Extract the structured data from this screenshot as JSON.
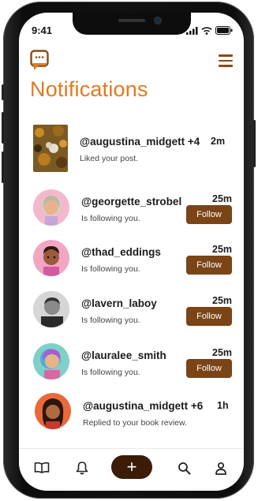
{
  "status_bar": {
    "time": "9:41"
  },
  "header": {
    "title": "Notifications"
  },
  "notifications": [
    {
      "username": "@augustina_midgett +4",
      "message": "Liked your post.",
      "time": "2m"
    },
    {
      "username": "@georgette_strobel",
      "message": "Is following you.",
      "time": "25m",
      "button": "Follow"
    },
    {
      "username": "@thad_eddings",
      "message": "Is following you.",
      "time": "25m",
      "button": "Follow"
    },
    {
      "username": "@lavern_laboy",
      "message": "Is following you.",
      "time": "25m",
      "button": "Follow"
    },
    {
      "username": "@lauralee_smith",
      "message": "Is following you.",
      "time": "25m",
      "button": "Follow"
    },
    {
      "username": "@augustina_midgett +6",
      "message": "Replied to your book review.",
      "time": "1h"
    }
  ],
  "bottom_nav": {
    "items": [
      "book-icon",
      "bell-icon",
      "add-icon",
      "search-icon",
      "profile-icon"
    ],
    "add_label": "+"
  },
  "colors": {
    "accent": "#e07a1f",
    "button": "#7a4416",
    "dark": "#3a1c07"
  }
}
